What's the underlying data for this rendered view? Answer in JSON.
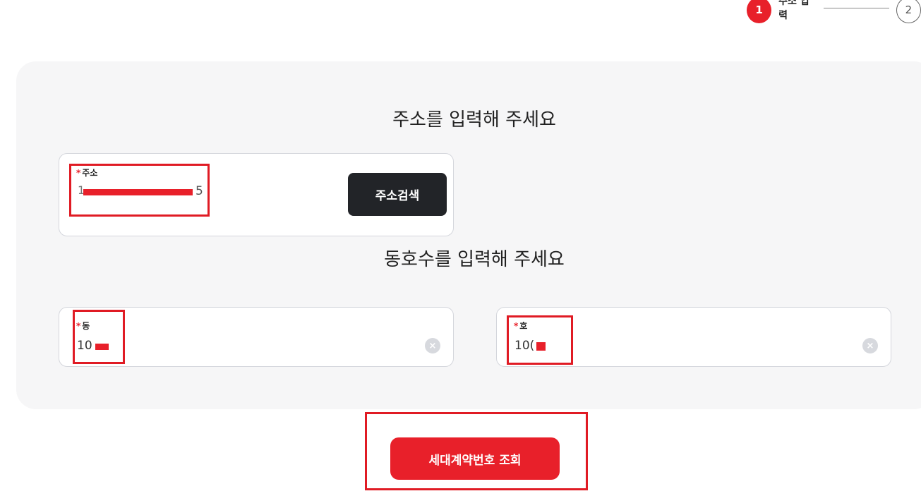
{
  "stepper": {
    "step1_number": "1",
    "step1_label": "주소 입력",
    "step2_number": "2"
  },
  "address_section": {
    "title": "주소를 입력해 주세요",
    "field_label": "주소",
    "required_mark": "*",
    "value_prefix": "1",
    "value_suffix": "5",
    "search_button": "주소검색"
  },
  "unit_section": {
    "title": "동호수를 입력해 주세요",
    "dong": {
      "label": "동",
      "required_mark": "*",
      "value": "10"
    },
    "ho": {
      "label": "호",
      "required_mark": "*",
      "value": "10("
    },
    "clear_icon": "×"
  },
  "submit_button": "세대계약번호 조회",
  "colors": {
    "accent": "#e8202a",
    "dark_button": "#222428",
    "panel_bg": "#f6f6f7",
    "highlight": "#e01b24"
  }
}
